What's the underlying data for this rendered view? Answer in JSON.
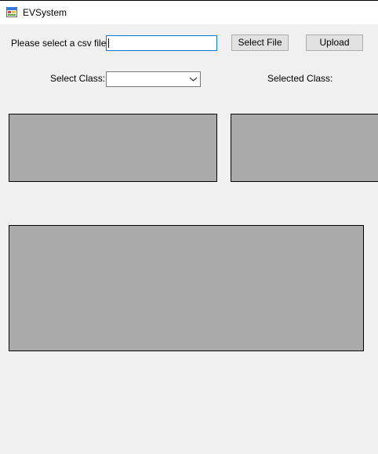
{
  "window": {
    "title": "EVSystem",
    "icon": "winforms-app-icon"
  },
  "file_row": {
    "label": "Please select a csv file:",
    "input_value": "",
    "select_button_label": "Select File",
    "upload_button_label": "Upload"
  },
  "class_row": {
    "select_label": "Select Class:",
    "selected_value": "",
    "selected_label": "Selected Class:"
  },
  "colors": {
    "window_bg": "#f0f0f0",
    "panel_bg": "#aaaaaa",
    "input_focus_border": "#0078d7",
    "button_bg": "#e1e1e1"
  }
}
